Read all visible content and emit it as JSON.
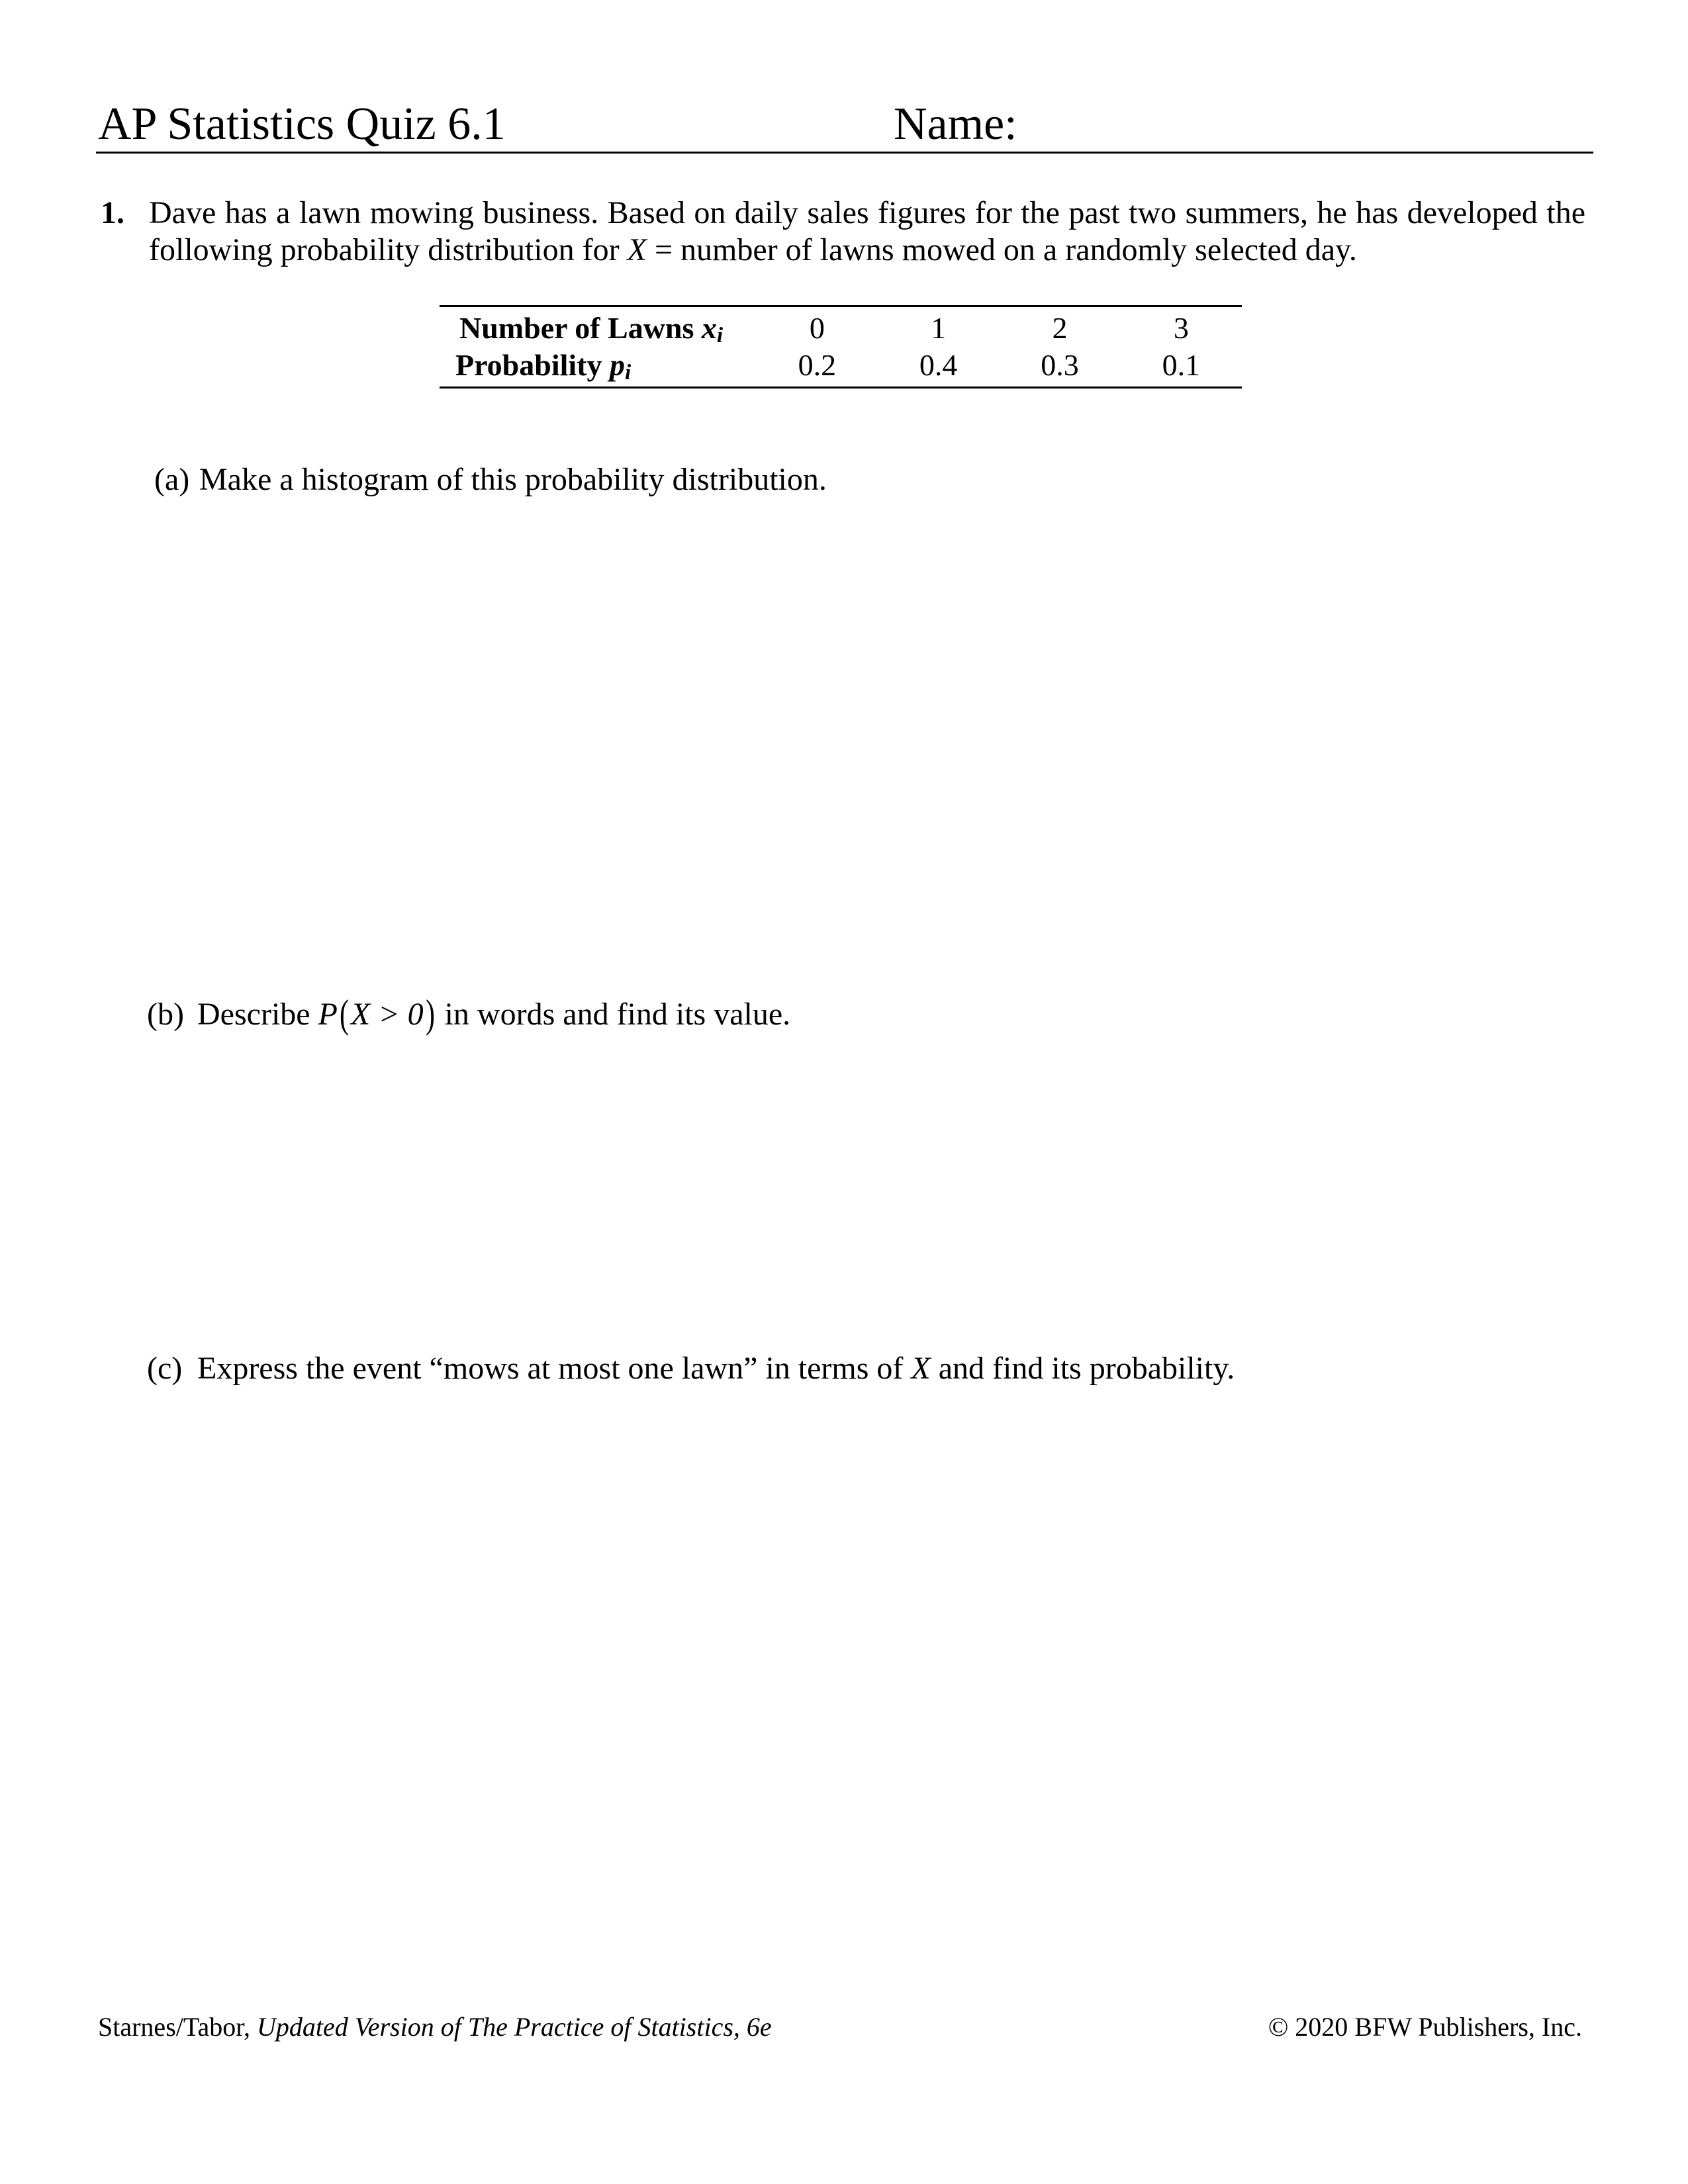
{
  "header": {
    "title": "AP Statistics Quiz 6.1",
    "name_label": "Name:"
  },
  "question1": {
    "number": "1.",
    "text_part1": "Dave has a lawn mowing business.  Based on daily sales figures for the past two summers, he has developed the following probability distribution for ",
    "variable": "X",
    "text_part2": " = number of lawns mowed on a randomly selected day."
  },
  "table": {
    "row1_label": "Number of Lawns ",
    "row1_symbol": "x",
    "row1_subscript": "i",
    "row2_label": "Probability ",
    "row2_symbol": "p",
    "row2_subscript": "i",
    "x_values": [
      "0",
      "1",
      "2",
      "3"
    ],
    "p_values": [
      "0.2",
      "0.4",
      "0.3",
      "0.1"
    ]
  },
  "parts": {
    "a": {
      "label": "(a)",
      "text": "Make a histogram of this probability distribution."
    },
    "b": {
      "label": "(b)",
      "text_before": "Describe ",
      "math_P": "P",
      "math_open": "(",
      "math_inner": "X > 0",
      "math_close": ")",
      "text_after": " in words and find its value."
    },
    "c": {
      "label": "(c)",
      "text_before": "Express the event “mows at most one lawn” in terms of ",
      "variable": "X",
      "text_after": " and find its probability."
    }
  },
  "footer": {
    "authors": "Starnes/Tabor, ",
    "book_title": "Updated Version of The Practice of Statistics, 6e",
    "copyright": "© 2020 BFW Publishers, Inc."
  }
}
